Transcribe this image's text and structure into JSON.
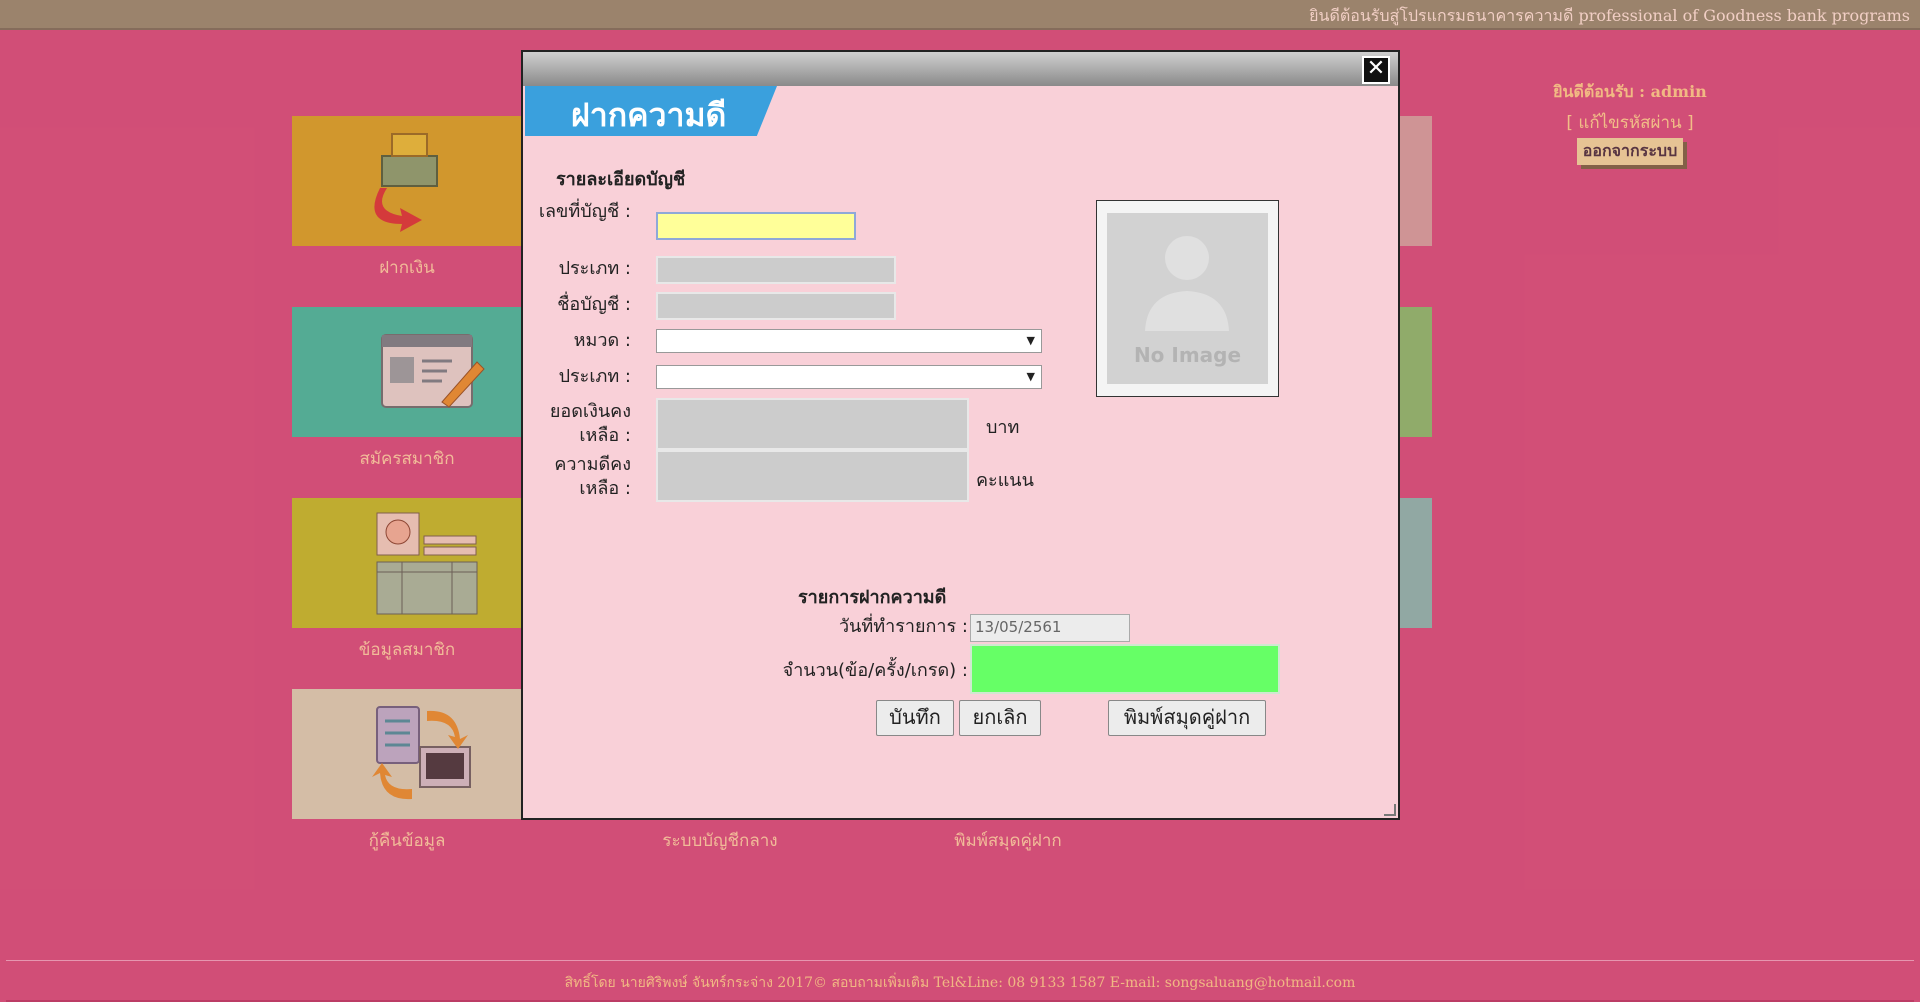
{
  "topbar": {
    "text": "ยินดีต้อนรับสู่โปรแกรมธนาคารความดี professional of Goodness bank programs"
  },
  "tiles": [
    {
      "label": "ฝากเงิน",
      "color": "#d4b617"
    },
    {
      "label": "สมัครสมาชิก",
      "color": "#2ed1a0"
    },
    {
      "label": "ข้อมูลสมาชิก",
      "color": "#bcd21b"
    },
    {
      "label": "กู้คืนข้อมูล",
      "color": "#d8e8b8"
    },
    {
      "label": "ระบบบัญชีกลาง",
      "color": "#d5557a"
    },
    {
      "label": "พิมพ์สมุดคู่ฝาก",
      "color": "#d5557a"
    }
  ],
  "right_tiles": [
    {
      "color": "#d2b2a2"
    },
    {
      "color": "#7ed068"
    },
    {
      "color": "#7fcdb5"
    }
  ],
  "user": {
    "welcome": "ยินดีต้อนรับ : admin",
    "change_password": "[ แก้ไขรหัสผ่าน ]",
    "logout": "ออกจากระบบ"
  },
  "modal": {
    "title": "ฝากความดี",
    "account_section": "รายละเอียดบัญชี",
    "fields": {
      "account_no_label": "เลขที่บัญชี :",
      "type_label": "ประเภท :",
      "account_name_label": "ชื่อบัญชี :",
      "category_label": "หมวด :",
      "type2_label": "ประเภท :",
      "balance_label": "ยอดเงินคงเหลือ :",
      "goodness_balance_label": "ความดีคงเหลือ :",
      "balance_unit": "บาท",
      "goodness_unit": "คะแนน"
    },
    "photo_text": "No Image",
    "transaction_section": "รายการฝากความดี",
    "date_label": "วันที่ทำรายการ :",
    "date_value": "13/05/2561",
    "amount_label": "จำนวน(ข้อ/ครั้ง/เกรด) :",
    "save_button": "บันทึก",
    "cancel_button": "ยกเลิก",
    "print_button": "พิมพ์สมุดคู่ฝาก",
    "close_icon": "close-icon"
  },
  "footer": {
    "text": "สิทธิ์โดย นายศิริพงษ์ จันทร์กระจ่าง 2017© สอบถามเพิ่มเติม Tel&Line: 08 9133 1587 E-mail: songsaluang@hotmail.com"
  }
}
